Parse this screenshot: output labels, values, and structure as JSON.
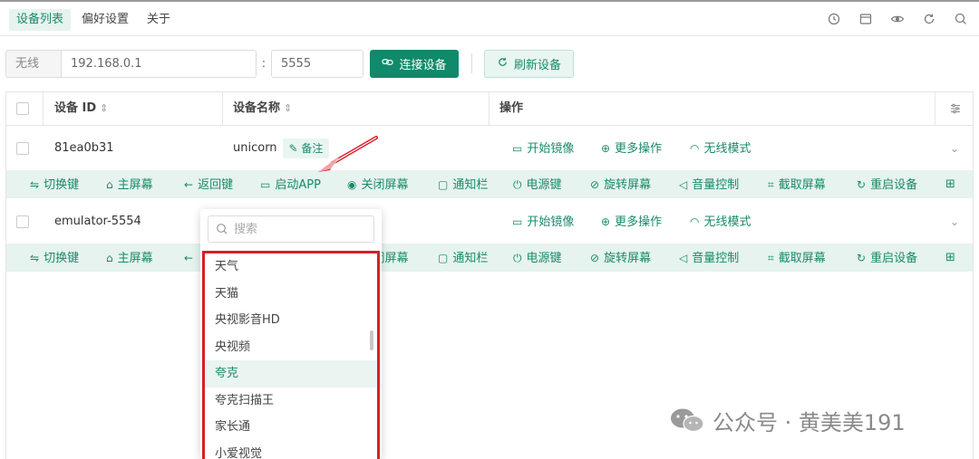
{
  "nav": {
    "tabs": [
      {
        "label": "设备列表",
        "active": true
      },
      {
        "label": "偏好设置",
        "active": false
      },
      {
        "label": "关于",
        "active": false
      }
    ],
    "icons": [
      "clock-icon",
      "window-icon",
      "eye-icon",
      "refresh-icon",
      "search-icon"
    ]
  },
  "connect": {
    "prefix": "无线",
    "ip_value": "192.168.0.1",
    "separator": ":",
    "port_value": "5555",
    "connect_label": "连接设备",
    "refresh_label": "刷新设备"
  },
  "table": {
    "headers": {
      "id": "设备 ID",
      "name": "设备名称",
      "actions": "操作"
    },
    "rows": [
      {
        "id": "81ea0b31",
        "name": "unicorn",
        "note_label": "备注",
        "actions": [
          "开始镜像",
          "更多操作",
          "无线模式"
        ]
      },
      {
        "id": "emulator-5554",
        "name": "",
        "note_label": "",
        "actions": [
          "开始镜像",
          "更多操作",
          "无线模式"
        ]
      }
    ],
    "toolbar": [
      "切换键",
      "主屏幕",
      "返回键",
      "启动APP",
      "关闭屏幕",
      "通知栏",
      "电源键",
      "旋转屏幕",
      "音量控制",
      "截取屏幕",
      "重启设备"
    ]
  },
  "dropdown": {
    "placeholder": "搜索",
    "options": [
      "天气",
      "天猫",
      "央视影音HD",
      "央视频",
      "夸克",
      "夸克扫描王",
      "家长通",
      "小爱视觉"
    ],
    "highlighted": "夸克"
  },
  "watermark": {
    "text": "公众号 · 黄美美191"
  },
  "colors": {
    "primary": "#108a6a",
    "accent_text": "#1a8a6a",
    "strip_bg": "#e6f3ee",
    "annotation_red": "#d91e2a"
  }
}
